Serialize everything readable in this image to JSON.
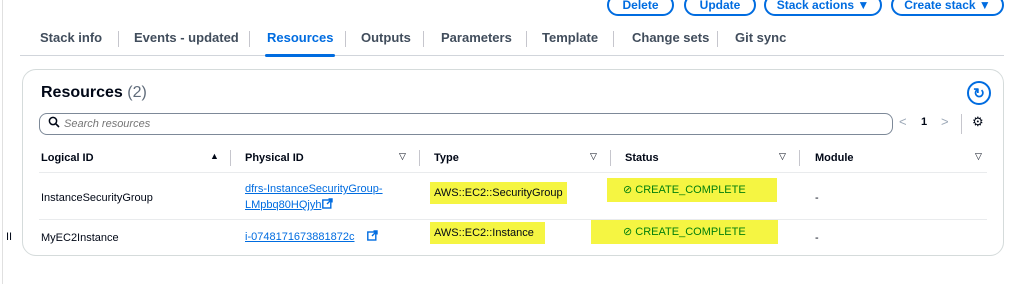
{
  "actions": {
    "delete": "Delete",
    "update": "Update",
    "stack_actions": "Stack actions ▼",
    "create_stack": "Create stack ▼"
  },
  "tabs": [
    {
      "label": "Stack info"
    },
    {
      "label": "Events - updated"
    },
    {
      "label": "Resources"
    },
    {
      "label": "Outputs"
    },
    {
      "label": "Parameters"
    },
    {
      "label": "Template"
    },
    {
      "label": "Change sets"
    },
    {
      "label": "Git sync"
    }
  ],
  "side_marker": "II",
  "panel": {
    "title": "Resources",
    "count": "(2)",
    "refresh_icon": "↻"
  },
  "search": {
    "placeholder": "Search resources",
    "icon": "search-icon"
  },
  "pagination": {
    "prev": "<",
    "page": "1",
    "next": ">",
    "settings_icon": "⚙"
  },
  "table": {
    "headers": {
      "logical_id": "Logical ID",
      "physical_id": "Physical ID",
      "type": "Type",
      "status": "Status",
      "module": "Module"
    },
    "sort_indicators": {
      "logical_id": "▲",
      "physical_id": "▽",
      "type": "▽",
      "status": "▽",
      "module": "▽"
    },
    "rows": [
      {
        "logical_id": "InstanceSecurityGroup",
        "physical_id_line1": "dfrs-InstanceSecurityGroup-",
        "physical_id_line2": "LMpbq80HQjyh",
        "type": "AWS::EC2::SecurityGroup",
        "status": "⊘ CREATE_COMPLETE",
        "module": "-"
      },
      {
        "logical_id": "MyEC2Instance",
        "physical_id_line1": "i-0748171673881872c",
        "type": "AWS::EC2::Instance",
        "status": "⊘ CREATE_COMPLETE",
        "module": "-"
      }
    ],
    "external_link_icon": "↗"
  },
  "colors": {
    "accent": "#006ce0",
    "highlight": "#f5f542",
    "success": "#037f0c"
  }
}
